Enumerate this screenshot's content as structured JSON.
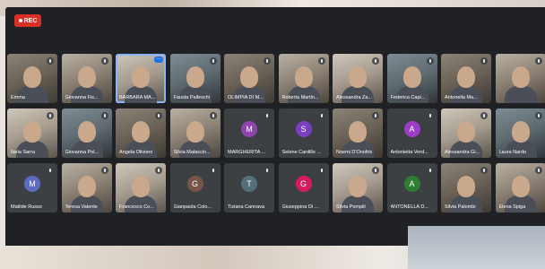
{
  "recording": {
    "label": "REC"
  },
  "participants": [
    {
      "name": "Emma",
      "kind": "video"
    },
    {
      "name": "Giovanna Fis...",
      "kind": "video"
    },
    {
      "name": "BARBARA MA...",
      "kind": "video",
      "speaking": true,
      "more": true
    },
    {
      "name": "Fausta Palleschi",
      "kind": "video"
    },
    {
      "name": "OLIMPIA DI M...",
      "kind": "video"
    },
    {
      "name": "Roberta Martin...",
      "kind": "video"
    },
    {
      "name": "Alessandra Za...",
      "kind": "video"
    },
    {
      "name": "Federica Capi...",
      "kind": "video"
    },
    {
      "name": "Antonella Ma...",
      "kind": "video"
    },
    {
      "name": "",
      "kind": "video"
    },
    {
      "name": "Ilaria Sarra",
      "kind": "video"
    },
    {
      "name": "Giovanna Pol...",
      "kind": "video"
    },
    {
      "name": "Angela Oliviero",
      "kind": "video"
    },
    {
      "name": "Silvia Mataccin...",
      "kind": "video"
    },
    {
      "name": "MARGHERITA ...",
      "kind": "avatar",
      "initial": "M",
      "color": "#8e44ad"
    },
    {
      "name": "Selene Cardillo ...",
      "kind": "avatar",
      "initial": "S",
      "color": "#7b3fc2"
    },
    {
      "name": "Noemi D'Onofrio",
      "kind": "video"
    },
    {
      "name": "Antonietta Verd...",
      "kind": "avatar",
      "initial": "A",
      "color": "#9c3fc4"
    },
    {
      "name": "Alessandra Gi...",
      "kind": "video"
    },
    {
      "name": "Laura Nardo",
      "kind": "video"
    },
    {
      "name": "Matilde Russo",
      "kind": "avatar",
      "initial": "M",
      "color": "#5c6bc0"
    },
    {
      "name": "Teresa Valente",
      "kind": "video"
    },
    {
      "name": "Francesco Co...",
      "kind": "video"
    },
    {
      "name": "Gianpaola Colo...",
      "kind": "avatar",
      "initial": "G",
      "color": "#795548"
    },
    {
      "name": "Tiziana Cannava",
      "kind": "avatar",
      "initial": "T",
      "color": "#546e7a"
    },
    {
      "name": "Giuseppina Di ...",
      "kind": "avatar",
      "initial": "G",
      "color": "#d81b60"
    },
    {
      "name": "Silvia Pompili",
      "kind": "video"
    },
    {
      "name": "ANTONELLA D...",
      "kind": "avatar",
      "initial": "A",
      "color": "#2e7d32"
    },
    {
      "name": "Silvia Palombi",
      "kind": "video"
    },
    {
      "name": "Elena Spiga",
      "kind": "video"
    }
  ]
}
